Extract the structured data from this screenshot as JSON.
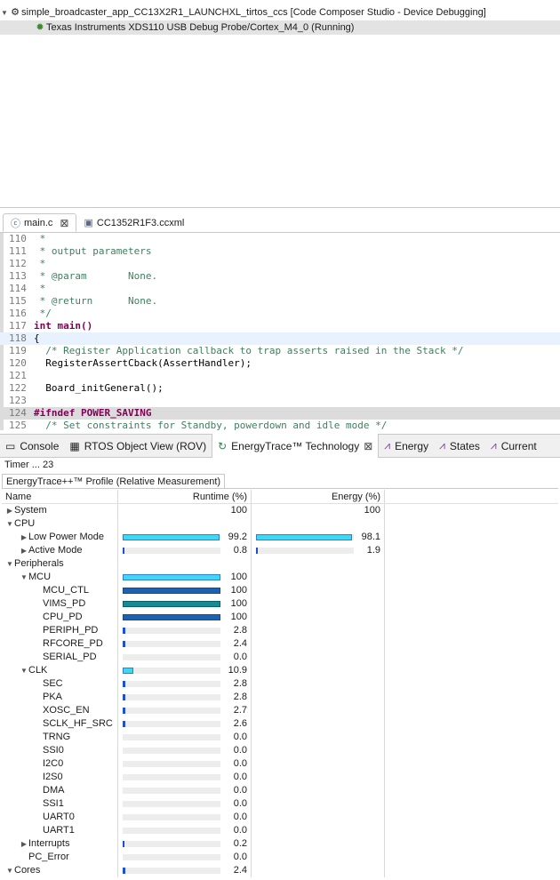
{
  "debug": {
    "project": "simple_broadcaster_app_CC13X2R1_LAUNCHXL_tirtos_ccs [Code Composer Studio - Device Debugging]",
    "probe": "Texas Instruments XDS110 USB Debug Probe/Cortex_M4_0 (Running)"
  },
  "editor": {
    "tabs": [
      "main.c",
      "CC1352R1F3.ccxml"
    ],
    "lines": [
      {
        "n": "110",
        "t": " *"
      },
      {
        "n": "111",
        "t": " * output parameters"
      },
      {
        "n": "112",
        "t": " *"
      },
      {
        "n": "113",
        "t": " * @param       None."
      },
      {
        "n": "114",
        "t": " *"
      },
      {
        "n": "115",
        "t": " * @return      None."
      },
      {
        "n": "116",
        "t": " */"
      },
      {
        "n": "117",
        "t": "int main()"
      },
      {
        "n": "118",
        "t": "{"
      },
      {
        "n": "119",
        "t": "  /* Register Application callback to trap asserts raised in the Stack */"
      },
      {
        "n": "120",
        "t": "  RegisterAssertCback(AssertHandler);"
      },
      {
        "n": "121",
        "t": ""
      },
      {
        "n": "122",
        "t": "  Board_initGeneral();"
      },
      {
        "n": "123",
        "t": ""
      },
      {
        "n": "124",
        "t": "#ifndef POWER_SAVING"
      },
      {
        "n": "125",
        "t": "  /* Set constraints for Standby, powerdown and idle mode */"
      }
    ]
  },
  "views": {
    "tabs": [
      "Console",
      "RTOS Object View (ROV)",
      "EnergyTrace™ Technology",
      "Energy",
      "States",
      "Current"
    ],
    "timer": "Timer ... 23",
    "profile_title": "EnergyTrace++™ Profile (Relative Measurement)",
    "columns": {
      "name": "Name",
      "runtime": "Runtime (%)",
      "energy": "Energy (%)"
    },
    "rows": [
      {
        "name": "System",
        "lvl": 0,
        "arrow": "▶",
        "rt": "100",
        "en": "100",
        "rtf": null,
        "enf": null
      },
      {
        "name": "CPU",
        "lvl": 0,
        "arrow": "▼",
        "rt": "",
        "en": "",
        "rtf": null,
        "enf": null
      },
      {
        "name": "Low Power Mode",
        "lvl": 1,
        "arrow": "▶",
        "rt": "99.2",
        "en": "98.1",
        "rtf": 0.992,
        "enf": 0.981,
        "style": "cyan"
      },
      {
        "name": "Active Mode",
        "lvl": 1,
        "arrow": "▶",
        "rt": "0.8",
        "en": "1.9",
        "rtf": 0.008,
        "enf": 0.019
      },
      {
        "name": "Peripherals",
        "lvl": 0,
        "arrow": "▼",
        "rt": "",
        "en": "",
        "rtf": null,
        "enf": null
      },
      {
        "name": "MCU",
        "lvl": 1,
        "arrow": "▼",
        "rt": "100",
        "en": "",
        "rtf": 1.0,
        "enf": null,
        "style": "cyan"
      },
      {
        "name": "MCU_CTL",
        "lvl": 2,
        "arrow": "",
        "rt": "100",
        "en": "",
        "rtf": 1.0,
        "enf": null,
        "style": "dark"
      },
      {
        "name": "VIMS_PD",
        "lvl": 2,
        "arrow": "",
        "rt": "100",
        "en": "",
        "rtf": 1.0,
        "enf": null,
        "style": "teal"
      },
      {
        "name": "CPU_PD",
        "lvl": 2,
        "arrow": "",
        "rt": "100",
        "en": "",
        "rtf": 1.0,
        "enf": null,
        "style": "dark"
      },
      {
        "name": "PERIPH_PD",
        "lvl": 2,
        "arrow": "",
        "rt": "2.8",
        "en": "",
        "rtf": 0.028,
        "enf": null
      },
      {
        "name": "RFCORE_PD",
        "lvl": 2,
        "arrow": "",
        "rt": "2.4",
        "en": "",
        "rtf": 0.024,
        "enf": null
      },
      {
        "name": "SERIAL_PD",
        "lvl": 2,
        "arrow": "",
        "rt": "0.0",
        "en": "",
        "rtf": 0.0,
        "enf": null
      },
      {
        "name": "CLK",
        "lvl": 1,
        "arrow": "▼",
        "rt": "10.9",
        "en": "",
        "rtf": 0.109,
        "enf": null,
        "style": "cyan"
      },
      {
        "name": "SEC",
        "lvl": 2,
        "arrow": "",
        "rt": "2.8",
        "en": "",
        "rtf": 0.028,
        "enf": null
      },
      {
        "name": "PKA",
        "lvl": 2,
        "arrow": "",
        "rt": "2.8",
        "en": "",
        "rtf": 0.028,
        "enf": null
      },
      {
        "name": "XOSC_EN",
        "lvl": 2,
        "arrow": "",
        "rt": "2.7",
        "en": "",
        "rtf": 0.027,
        "enf": null
      },
      {
        "name": "SCLK_HF_SRC",
        "lvl": 2,
        "arrow": "",
        "rt": "2.6",
        "en": "",
        "rtf": 0.026,
        "enf": null
      },
      {
        "name": "TRNG",
        "lvl": 2,
        "arrow": "",
        "rt": "0.0",
        "en": "",
        "rtf": 0.0,
        "enf": null
      },
      {
        "name": "SSI0",
        "lvl": 2,
        "arrow": "",
        "rt": "0.0",
        "en": "",
        "rtf": 0.0,
        "enf": null
      },
      {
        "name": "I2C0",
        "lvl": 2,
        "arrow": "",
        "rt": "0.0",
        "en": "",
        "rtf": 0.0,
        "enf": null
      },
      {
        "name": "I2S0",
        "lvl": 2,
        "arrow": "",
        "rt": "0.0",
        "en": "",
        "rtf": 0.0,
        "enf": null
      },
      {
        "name": "DMA",
        "lvl": 2,
        "arrow": "",
        "rt": "0.0",
        "en": "",
        "rtf": 0.0,
        "enf": null
      },
      {
        "name": "SSI1",
        "lvl": 2,
        "arrow": "",
        "rt": "0.0",
        "en": "",
        "rtf": 0.0,
        "enf": null
      },
      {
        "name": "UART0",
        "lvl": 2,
        "arrow": "",
        "rt": "0.0",
        "en": "",
        "rtf": 0.0,
        "enf": null
      },
      {
        "name": "UART1",
        "lvl": 2,
        "arrow": "",
        "rt": "0.0",
        "en": "",
        "rtf": 0.0,
        "enf": null
      },
      {
        "name": "Interrupts",
        "lvl": 1,
        "arrow": "▶",
        "rt": "0.2",
        "en": "",
        "rtf": 0.002,
        "enf": null
      },
      {
        "name": "PC_Error",
        "lvl": 1,
        "arrow": "",
        "rt": "0.0",
        "en": "",
        "rtf": 0.0,
        "enf": null
      },
      {
        "name": "Cores",
        "lvl": 0,
        "arrow": "▼",
        "rt": "2.4",
        "en": "",
        "rtf": 0.024,
        "enf": null
      }
    ]
  },
  "colors": {
    "accent_bar": "#1a4fd6",
    "cyan_bar": "#3fd6f7",
    "teal_bar": "#138a94",
    "current_line": "#e8f2fe"
  }
}
